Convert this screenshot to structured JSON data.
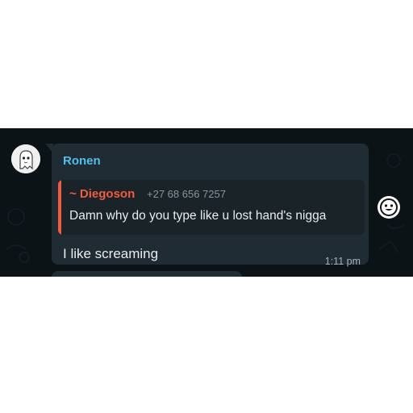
{
  "message": {
    "sender": "Ronen",
    "reply": {
      "author": "~ Diegoson",
      "phone": "+27 68 656 7257",
      "text": "Damn why do you type like u lost hand's nigga"
    },
    "text": "I like screaming",
    "time": "1:11 pm"
  },
  "icons": {
    "avatar": "ghost-avatar-icon",
    "react": "smiley-emoji-icon"
  },
  "colors": {
    "chat_background": "#0c1317",
    "bubble": "#202c33",
    "sender_name": "#53bdeb",
    "reply_accent": "#f15c3c",
    "text": "#e9edef",
    "meta": "#8696a0"
  }
}
